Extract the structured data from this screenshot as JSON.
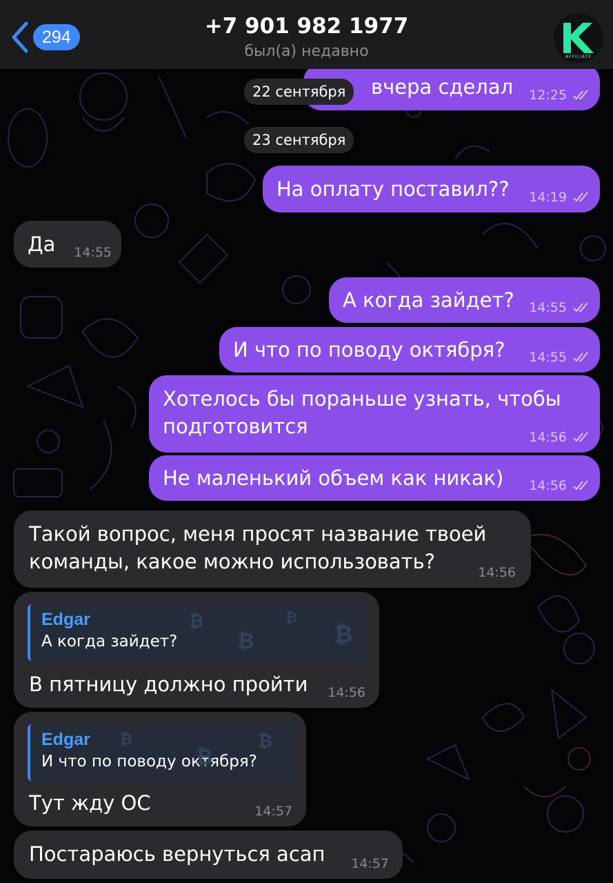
{
  "header": {
    "back_count": "294",
    "title": "+7 901 982 1977",
    "subtitle": "был(а) недавно",
    "avatar_letter": "K",
    "avatar_caption": "AFFILIATE"
  },
  "dates": [
    "22 сентября",
    "23 сентября"
  ],
  "messages": [
    {
      "dir": "out",
      "text": "вчера сделал",
      "time": "12:25"
    },
    {
      "dir": "out",
      "text": "На оплату поставил??",
      "time": "14:19"
    },
    {
      "dir": "in",
      "text": "Да",
      "time": "14:55"
    },
    {
      "dir": "out",
      "text": "А когда зайдет?",
      "time": "14:55"
    },
    {
      "dir": "out",
      "text": "И что по поводу октября?",
      "time": "14:55"
    },
    {
      "dir": "out",
      "text": "Хотелось бы пораньше узнать, чтобы\nподготовится",
      "time": "14:56"
    },
    {
      "dir": "out",
      "text": "Не маленький объем как никак)",
      "time": "14:56"
    },
    {
      "dir": "in",
      "text": "Такой вопрос, меня просят название твоей\nкоманды, какое можно использовать?",
      "time": "14:56"
    },
    {
      "dir": "in",
      "reply": {
        "name": "Edgar",
        "text": "А когда зайдет?"
      },
      "text": "В пятницу должно пройти",
      "time": "14:56"
    },
    {
      "dir": "in",
      "reply": {
        "name": "Edgar",
        "text": "И что по поводу октября?"
      },
      "text": "Тут жду ОС",
      "time": "14:57"
    },
    {
      "dir": "in",
      "text": "Постараюсь вернуться асап",
      "time": "14:57"
    }
  ],
  "colors": {
    "outgoing": "#8b4ee8",
    "incoming": "#2b2b2f",
    "accent": "#3e88f7",
    "avatar_mark": "#2ee6a0"
  },
  "icons": {
    "back": "chevron-left-icon",
    "read": "double-check-icon",
    "reply_pattern": "bitcoin-icon"
  }
}
